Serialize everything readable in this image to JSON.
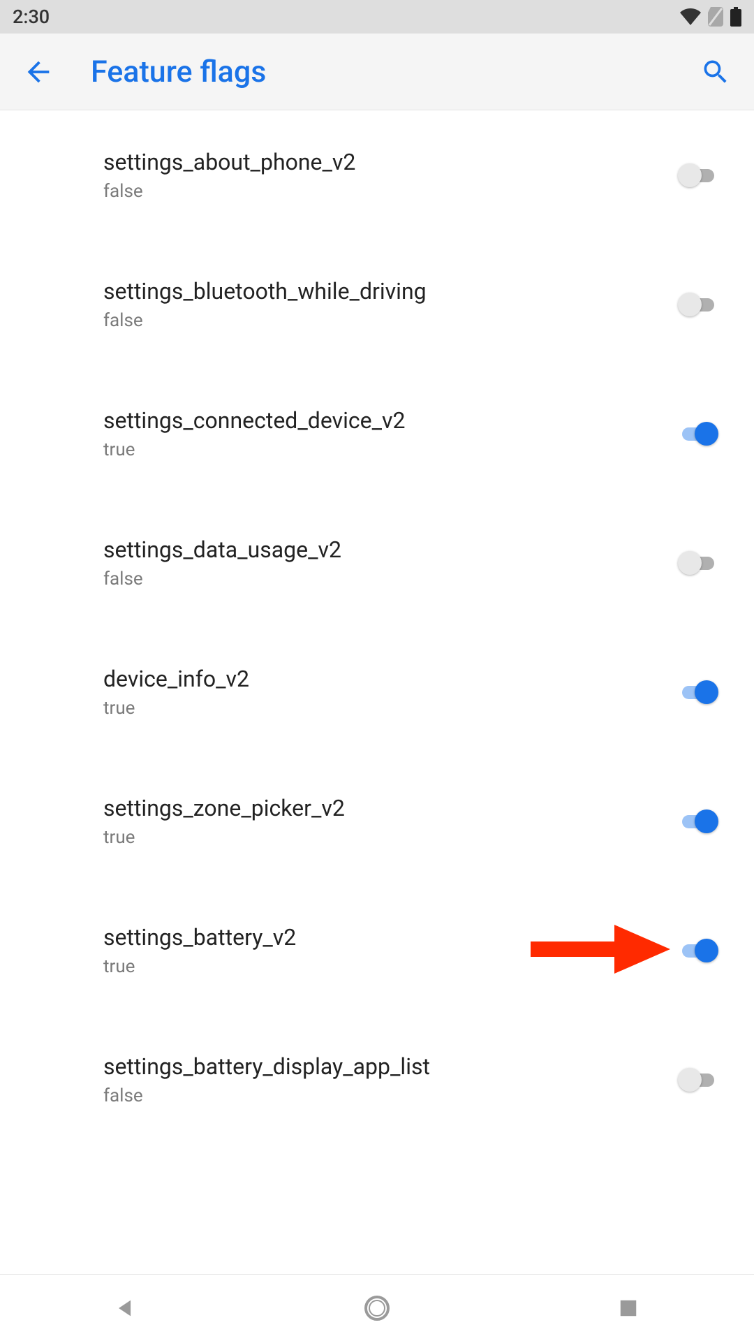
{
  "status": {
    "time": "2:30"
  },
  "header": {
    "title": "Feature flags"
  },
  "flags": [
    {
      "name": "settings_about_phone_v2",
      "value": "false",
      "on": false
    },
    {
      "name": "settings_bluetooth_while_driving",
      "value": "false",
      "on": false
    },
    {
      "name": "settings_connected_device_v2",
      "value": "true",
      "on": true
    },
    {
      "name": "settings_data_usage_v2",
      "value": "false",
      "on": false
    },
    {
      "name": "device_info_v2",
      "value": "true",
      "on": true
    },
    {
      "name": "settings_zone_picker_v2",
      "value": "true",
      "on": true
    },
    {
      "name": "settings_battery_v2",
      "value": "true",
      "on": true,
      "annotated": true
    },
    {
      "name": "settings_battery_display_app_list",
      "value": "false",
      "on": false
    }
  ],
  "colors": {
    "accent": "#1a73e8",
    "annotation": "#ff2a00"
  }
}
